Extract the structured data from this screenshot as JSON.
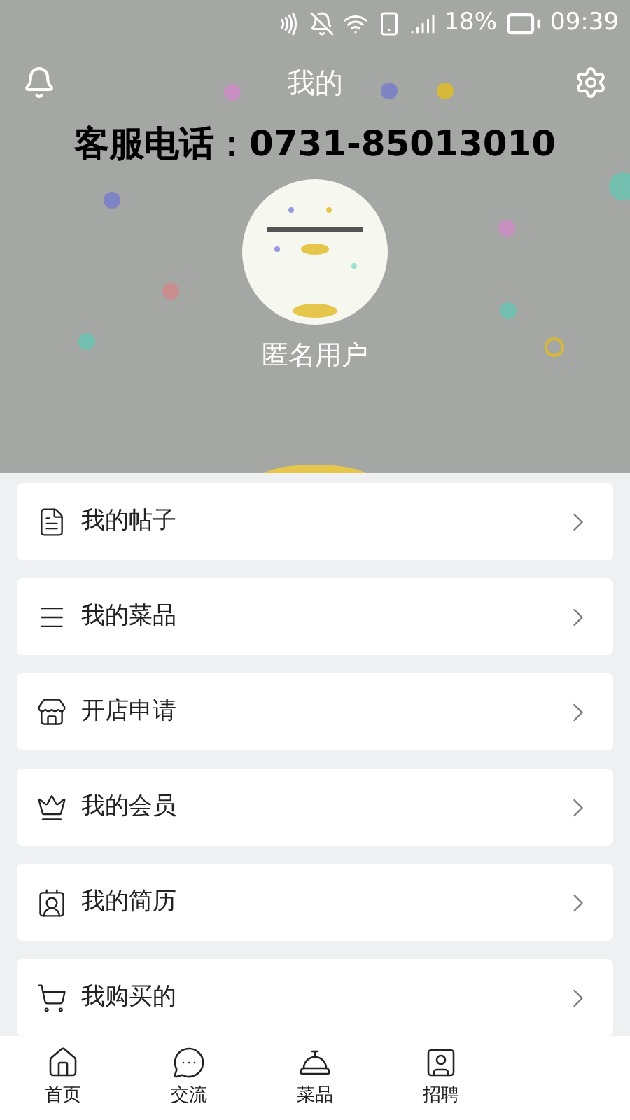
{
  "status_bar": {
    "battery": "18%",
    "time": "09:39"
  },
  "header": {
    "title": "我的",
    "banner": "客服电话：0731-85013010",
    "username": "匿名用户"
  },
  "menu": [
    {
      "kind": "posts",
      "label": "我的帖子"
    },
    {
      "kind": "dishes",
      "label": "我的菜品"
    },
    {
      "kind": "shop",
      "label": "开店申请"
    },
    {
      "kind": "member",
      "label": "我的会员"
    },
    {
      "kind": "resume",
      "label": "我的简历"
    },
    {
      "kind": "cart",
      "label": "我购买的"
    }
  ],
  "tab_bar": [
    {
      "kind": "home",
      "label": "首页"
    },
    {
      "kind": "chat",
      "label": "交流"
    },
    {
      "kind": "dish",
      "label": "菜品"
    },
    {
      "kind": "jobs",
      "label": "招聘"
    }
  ]
}
